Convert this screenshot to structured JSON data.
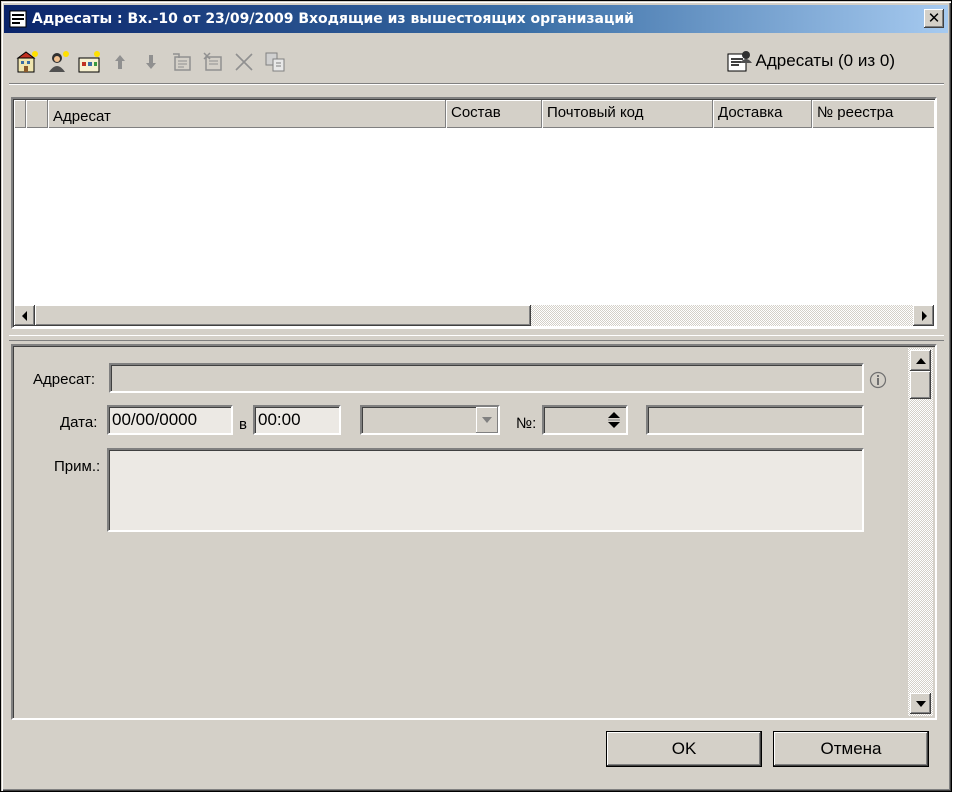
{
  "window": {
    "title": "Адресаты : Вх.-10 от 23/09/2009 Входящие из вышестоящих организаций",
    "close_glyph": "✕"
  },
  "toolbar": {
    "buttons": [
      {
        "name": "add-organization",
        "icon": "building-add-icon"
      },
      {
        "name": "add-person",
        "icon": "person-add-icon"
      },
      {
        "name": "add-group",
        "icon": "group-add-icon"
      },
      {
        "name": "move-up",
        "icon": "arrow-up-icon"
      },
      {
        "name": "move-down",
        "icon": "arrow-down-icon"
      },
      {
        "name": "edit-card",
        "icon": "card-edit-icon"
      },
      {
        "name": "clear-card",
        "icon": "card-clear-icon"
      },
      {
        "name": "delete",
        "icon": "delete-x-icon"
      },
      {
        "name": "copy",
        "icon": "copy-icon"
      }
    ],
    "count_label": "Адресаты (0 из 0)"
  },
  "grid": {
    "columns": [
      "",
      "",
      "Адресат",
      "Состав",
      "Почтовый код",
      "Доставка",
      "№ реестра"
    ],
    "rows": []
  },
  "form": {
    "addressee_label": "Адресат:",
    "addressee_value": "",
    "date_label": "Дата:",
    "date_value": "00/00/0000",
    "time_prefix": "в",
    "time_value": "00:00",
    "delivery_value": "",
    "number_label": "№:",
    "number_value": "",
    "extra_value": "",
    "note_label": "Прим.:",
    "note_value": ""
  },
  "buttons": {
    "ok": "OK",
    "cancel": "Отмена"
  },
  "colors": {
    "face": "#d4d0c8",
    "title_start": "#0a246a",
    "title_end": "#a6caf0"
  }
}
